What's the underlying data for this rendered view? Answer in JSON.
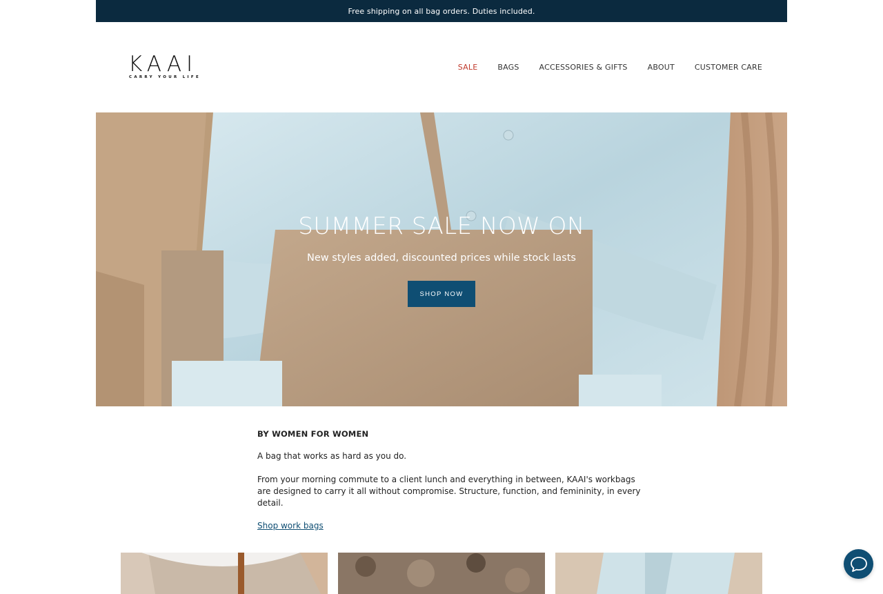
{
  "announcement": "Free shipping on all bag orders. Duties included.",
  "brand": {
    "name": "KAAI",
    "tagline": "CARRY YOUR LIFE"
  },
  "nav": [
    "SALE",
    "BAGS",
    "ACCESSORIES & GIFTS",
    "ABOUT",
    "CUSTOMER CARE"
  ],
  "hero": {
    "title": "SUMMER SALE NOW ON",
    "subtitle": "New styles added, discounted prices while stock lasts",
    "button": "SHOP NOW"
  },
  "story": {
    "heading": "BY WOMEN FOR WOMEN",
    "p1": "A bag that works as hard as you do.",
    "p2": "From your morning commute to a client lunch and everything in between, KAAI's workbags are designed to carry it all without compromise. Structure, function, and femininity, in every detail.",
    "link": "Shop work bags"
  },
  "colors": {
    "accent": "#0f4e73",
    "announcement_bg": "#0b2a3f",
    "sale": "#c0392b"
  },
  "icons": {
    "chat": "chat-bubble-icon"
  }
}
